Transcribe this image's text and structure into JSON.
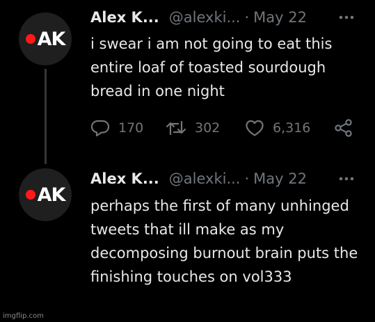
{
  "tweets": [
    {
      "avatar_text": "AK",
      "name": "Alex K...",
      "handle": "@alexki...",
      "separator": "·",
      "date": "May 22",
      "text": "i swear i am not going to eat this entire loaf of toasted sourdough bread in one night",
      "reply_count": "170",
      "retweet_count": "302",
      "like_count": "6,316"
    },
    {
      "avatar_text": "AK",
      "name": "Alex K...",
      "handle": "@alexki...",
      "separator": "·",
      "date": "May 22",
      "text": "perhaps the first of many unhinged tweets that ill make as my decomposing burnout brain puts the finishing touches on vol333"
    }
  ],
  "icons": {
    "reply": "reply-icon",
    "retweet": "retweet-icon",
    "like": "like-icon",
    "share": "share-icon",
    "more": "more-icon"
  },
  "colors": {
    "background": "#000000",
    "primary_text": "#e7e9ea",
    "secondary_text": "#71767b",
    "avatar_dot": "#ff1a1a"
  },
  "watermark": "imgflip.com"
}
